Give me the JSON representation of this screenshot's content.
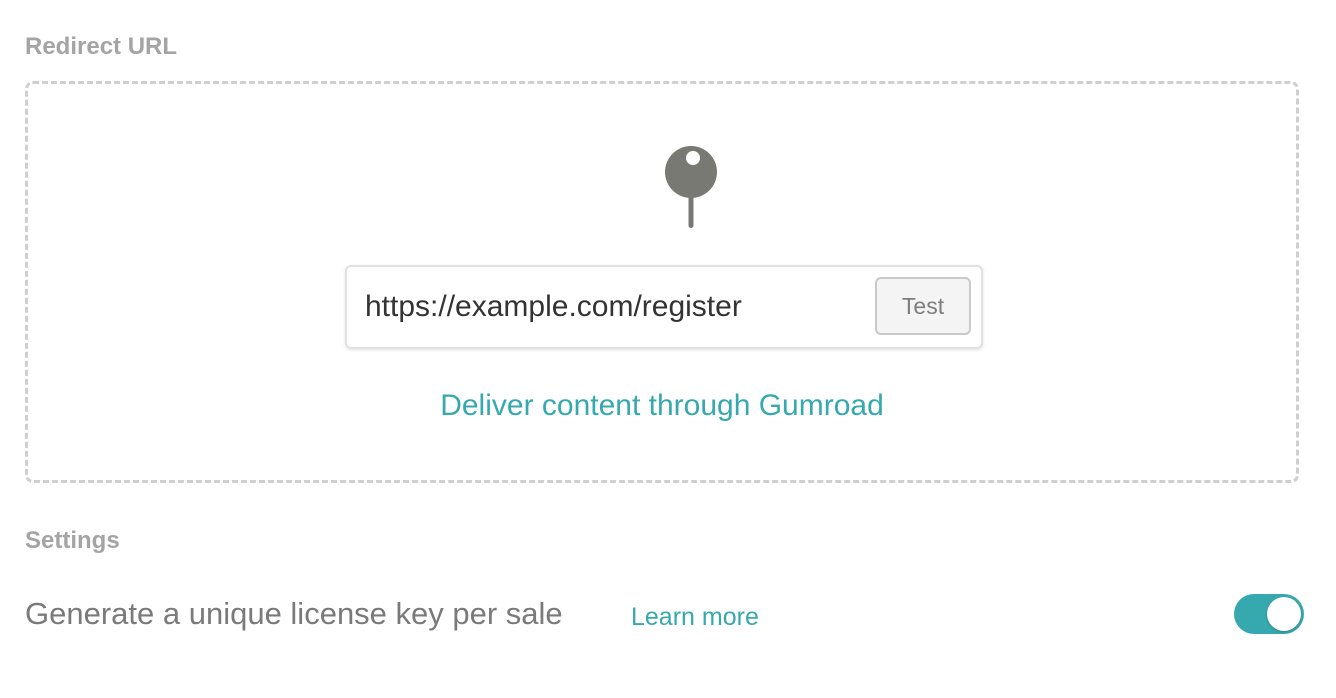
{
  "redirect_section": {
    "heading": "Redirect URL",
    "icon": "pin-icon",
    "url_input": {
      "value": "https://example.com/register",
      "placeholder": ""
    },
    "test_button_label": "Test",
    "deliver_link": "Deliver content through Gumroad"
  },
  "settings_section": {
    "heading": "Settings",
    "license_key_setting": {
      "label": "Generate a unique license key per sale",
      "learn_more": "Learn more",
      "enabled": true
    }
  },
  "colors": {
    "accent": "#36a9ae",
    "heading": "#a4a4a4",
    "icon": "#797974",
    "dashed_border": "#cfcfcf"
  }
}
